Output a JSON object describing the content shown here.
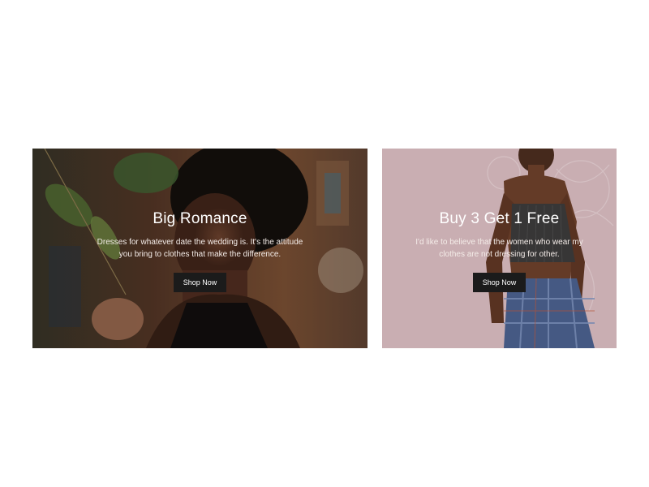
{
  "banners": [
    {
      "title": "Big Romance",
      "text": "Dresses for whatever date the wedding is. It's the attitude you bring to clothes that make the difference.",
      "button_label": "Shop Now",
      "image": "woman-with-plants-photo"
    },
    {
      "title": "Buy 3 Get 1 Free",
      "text": "I'd like to believe that the women who wear my clothes are not dressing for other.",
      "button_label": "Shop Now",
      "image": "woman-in-crop-top-photo"
    }
  ],
  "colors": {
    "button_bg": "#1b1b1b",
    "right_banner_bg": "#d6b9be",
    "text_white": "#ffffff"
  }
}
